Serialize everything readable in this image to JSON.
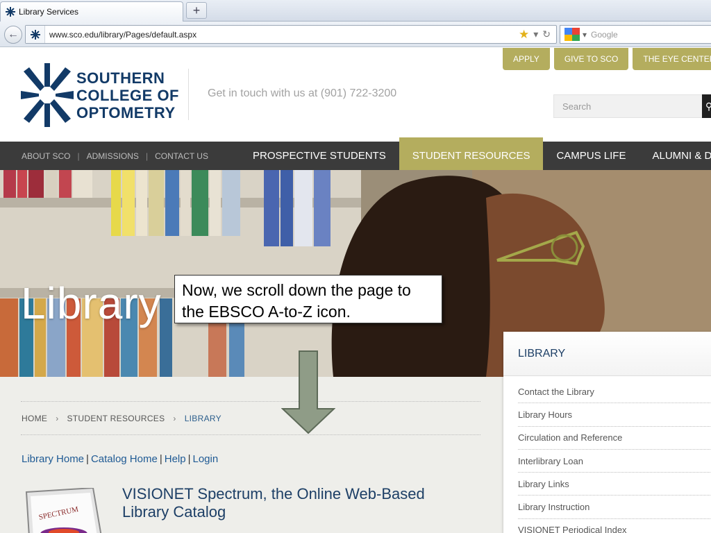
{
  "browser": {
    "tab_title": "Library Services",
    "new_tab": "+",
    "url": "www.sco.edu/library/Pages/default.aspx",
    "search_engine": "Google"
  },
  "header": {
    "logo_lines": [
      "SOUTHERN",
      "COLLEGE OF",
      "OPTOMETRY"
    ],
    "contact_line": "Get in touch with us at (901) 722-3200",
    "top_buttons": [
      "APPLY",
      "GIVE TO SCO",
      "THE EYE CENTER"
    ],
    "search_placeholder": "Search"
  },
  "nav": {
    "utility_links": [
      "ABOUT SCO",
      "ADMISSIONS",
      "CONTACT US"
    ],
    "main_items": [
      "PROSPECTIVE STUDENTS",
      "STUDENT RESOURCES",
      "CAMPUS LIFE",
      "ALUMNI & DONORS"
    ],
    "active_item": "STUDENT RESOURCES"
  },
  "hero": {
    "title": "Library"
  },
  "annotation": {
    "text": "Now, we scroll down the page to the EBSCO A-to-Z icon."
  },
  "breadcrumb": [
    "HOME",
    "STUDENT RESOURCES",
    "LIBRARY"
  ],
  "library_links": [
    "Library Home",
    "Catalog Home",
    "Help",
    "Login"
  ],
  "catalog": {
    "title_line1": "VISIONET Spectrum, the Online Web-Based",
    "title_line2": "Library Catalog",
    "image_label": "SPECTRUM"
  },
  "sidebar": {
    "heading": "LIBRARY",
    "items": [
      "Contact the Library",
      "Library Hours",
      "Circulation and Reference",
      "Interlibrary Loan",
      "Library Links",
      "Library Instruction",
      "VISIONET Periodical Index"
    ]
  },
  "colors": {
    "accent": "#b4ad5e",
    "nav_bg": "#3b3b3b",
    "brand_blue": "#123a67"
  }
}
